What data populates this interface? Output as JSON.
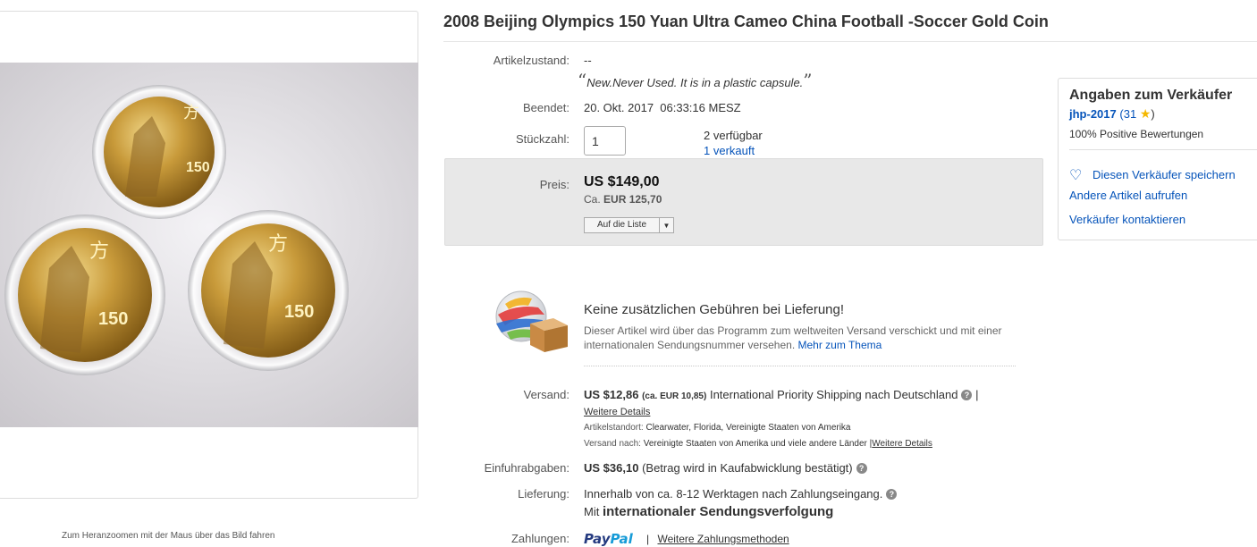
{
  "gallery": {
    "zoom_hint": "Zum Heranzoomen mit der Maus über das Bild fahren"
  },
  "item": {
    "title": "2008 Beijing Olympics 150 Yuan Ultra Cameo China Football -Soccer Gold Coin"
  },
  "condition": {
    "label": "Artikelzustand:",
    "value": "--",
    "quote_open": "“",
    "quote": "New.Never Used. It is in a plastic capsule.",
    "quote_close": "”"
  },
  "ended": {
    "label": "Beendet:",
    "value": "20. Okt. 2017  06:33:16 MESZ"
  },
  "quantity": {
    "label": "Stückzahl:",
    "value": "1",
    "available": "2 verfügbar",
    "sold": "1 verkauft"
  },
  "price": {
    "label": "Preis:",
    "value": "US $149,00",
    "converted_prefix": "Ca.",
    "converted_value": "EUR 125,70",
    "watch_button": "Auf die Liste",
    "watch_dropdown_icon": "caret-down-icon"
  },
  "seller": {
    "heading": "Angaben zum Verkäufer",
    "name": "jhp-2017",
    "feedback_open": "(",
    "feedback_count": "31",
    "feedback_close": ")",
    "star_icon": "star-icon",
    "positive": "100% Positive Bewertungen",
    "save_link": "Diesen Verkäufer speichern",
    "other_items_link": "Andere Artikel aufrufen",
    "contact_link": "Verkäufer kontaktieren"
  },
  "promo": {
    "title": "Keine zusätzlichen Gebühren bei Lieferung!",
    "text": "Dieser Artikel wird über das Programm zum weltweiten Versand verschickt und mit einer internationalen Sendungsnummer versehen.",
    "more_link": "Mehr zum Thema"
  },
  "shipping": {
    "label": "Versand:",
    "cost": "US $12,86",
    "cost_converted": "(ca. EUR 10,85)",
    "service": "International Priority Shipping nach Deutschland",
    "separator": "|",
    "details_link": "Weitere Details",
    "location_label": "Artikelstandort:",
    "location": "Clearwater, Florida, Vereinigte Staaten von Amerika",
    "ships_to_label": "Versand nach:",
    "ships_to": "Vereinigte Staaten von Amerika und viele andere Länder",
    "ships_to_sep": "|",
    "ships_to_link": "Weitere Details"
  },
  "import": {
    "label": "Einfuhrabgaben:",
    "value": "US $36,10",
    "note": "(Betrag wird in Kaufabwicklung bestätigt)"
  },
  "delivery": {
    "label": "Lieferung:",
    "value": "Innerhalb von ca. 8-12 Werktagen nach Zahlungseingang.",
    "tracking_prefix": "Mit",
    "tracking": "internationaler Sendungsverfolgung"
  },
  "payments": {
    "label": "Zahlungen:",
    "paypal_a": "Pay",
    "paypal_b": "Pal",
    "separator": "|",
    "more_link": "Weitere Zahlungsmethoden"
  },
  "colors": {
    "link": "#0654ba",
    "price_box": "#e8e8e8",
    "star": "#f5b800"
  }
}
